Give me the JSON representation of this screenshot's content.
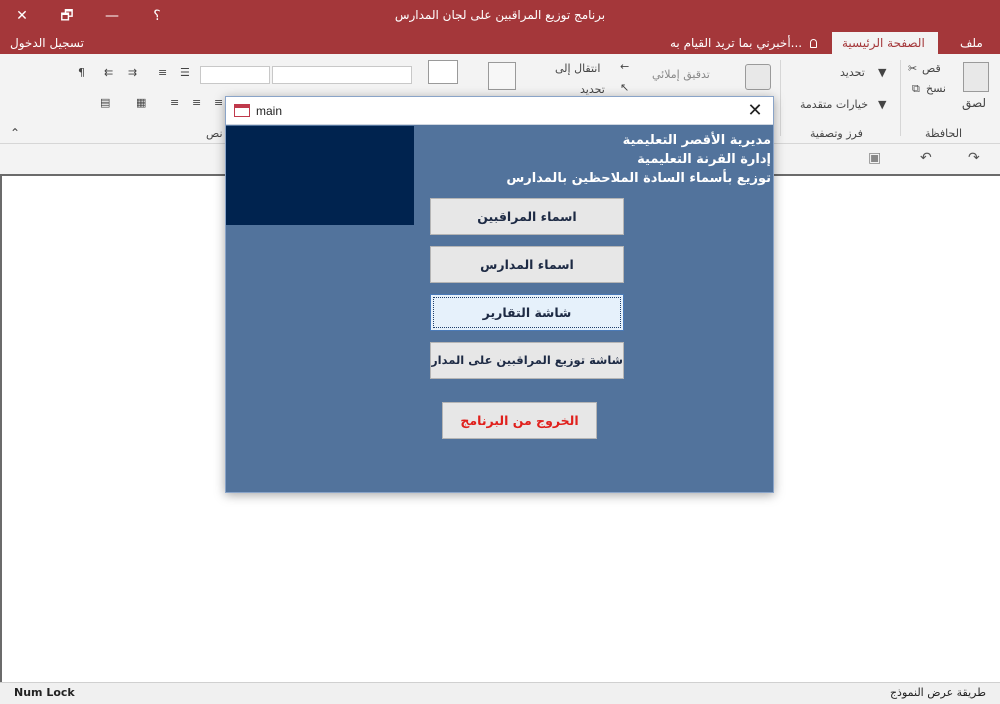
{
  "window": {
    "title": "برنامج توزيع المراقبين على لجان المدارس",
    "help": "؟",
    "minimize": "—",
    "restore": "🗗",
    "close": "✕"
  },
  "tabs": {
    "file": "ملف",
    "home": "الصفحة الرئيسية",
    "tell_me": "أخبرني بما تريد القيام به...",
    "sign_in": "تسجيل الدخول"
  },
  "ribbon": {
    "paste": "لصق",
    "cut": "قص",
    "copy": "نسخ",
    "clipboard_group": "الحافظة",
    "filter": "تحديد",
    "advanced_options": "خيارات متقدمة",
    "sort_filter_group": "فرز وتصفية",
    "spelling": "تدقيق إملائي",
    "goto": "انتقال إلى",
    "select": "تحديد",
    "text_group": "نص"
  },
  "dialog": {
    "title": "main",
    "close": "✕",
    "header_lines": [
      "مديرية الأقصر التعليمية",
      "إدارة القرنة التعليمية",
      "توزيع بأسماء السادة الملاحظين بالمدارس"
    ],
    "buttons": {
      "proctors": "اسماء المراقبين",
      "schools": "اسماء المدارس",
      "reports": "شاشة التقارير",
      "distribution": "شاشة توزيع المراقبين على المدارس",
      "exit": "الخروج من البرنامج"
    }
  },
  "statusbar": {
    "left": "Num Lock",
    "right": "طريقة عرض النموذج"
  },
  "colors": {
    "title_bar": "#a4373a",
    "form_background": "#52739c",
    "dark_panel": "#00234f",
    "exit_text": "#e0201c"
  }
}
